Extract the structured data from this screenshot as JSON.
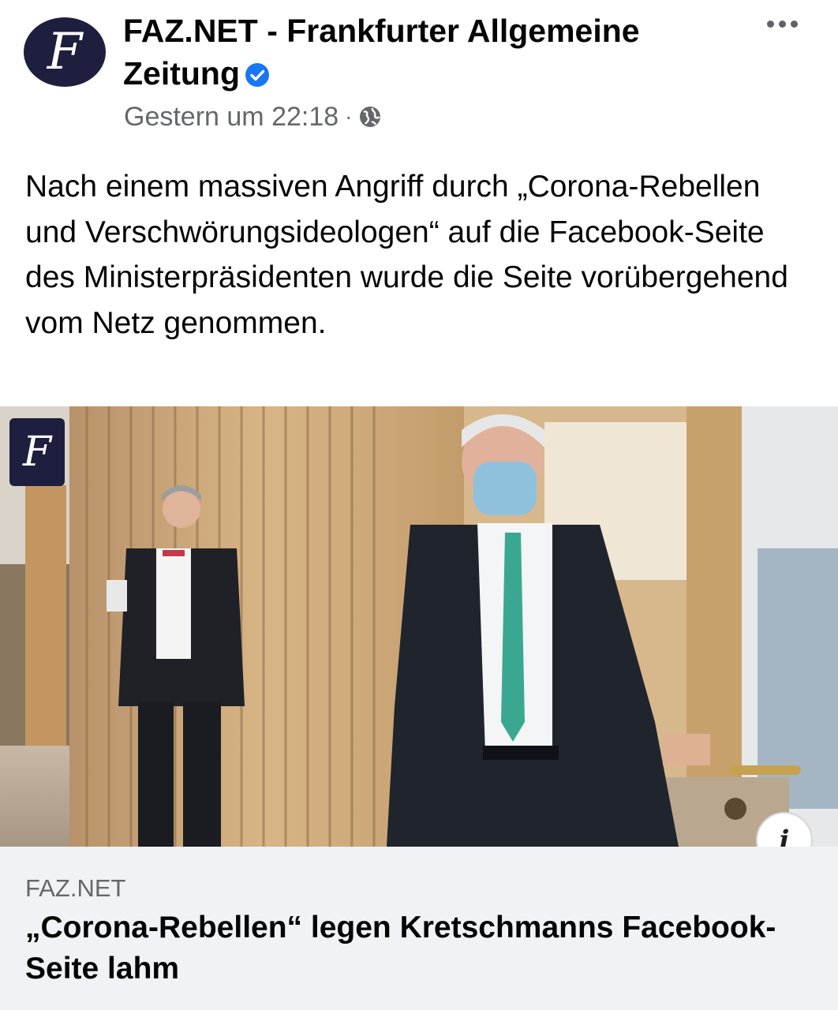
{
  "post": {
    "page_name": "FAZ.NET - Frankfurter Allgemeine Zeitung",
    "avatar_glyph": "F",
    "timestamp": "Gestern um 22:18",
    "separator": "·",
    "audience_icon": "globe-icon",
    "verified_icon": "verified-badge-icon",
    "more_icon": "more-options-icon",
    "text": "Nach einem massiven Angriff durch „Corona-Rebellen und Verschwörungsideologen“ auf die Facebook-Seite des Ministerpräsidenten wurde die Seite vorübergehend vom Netz genommen."
  },
  "link_preview": {
    "image_badge_glyph": "F",
    "info_glyph": "i",
    "domain": "FAZ.NET",
    "title": "„Corona-Rebellen“ legen Kretschmanns Facebook-Seite lahm"
  },
  "colors": {
    "brand_navy": "#1e1f3f",
    "verified_blue": "#1877f2",
    "meta_gray": "#65676b",
    "footer_bg": "#f0f2f5"
  }
}
